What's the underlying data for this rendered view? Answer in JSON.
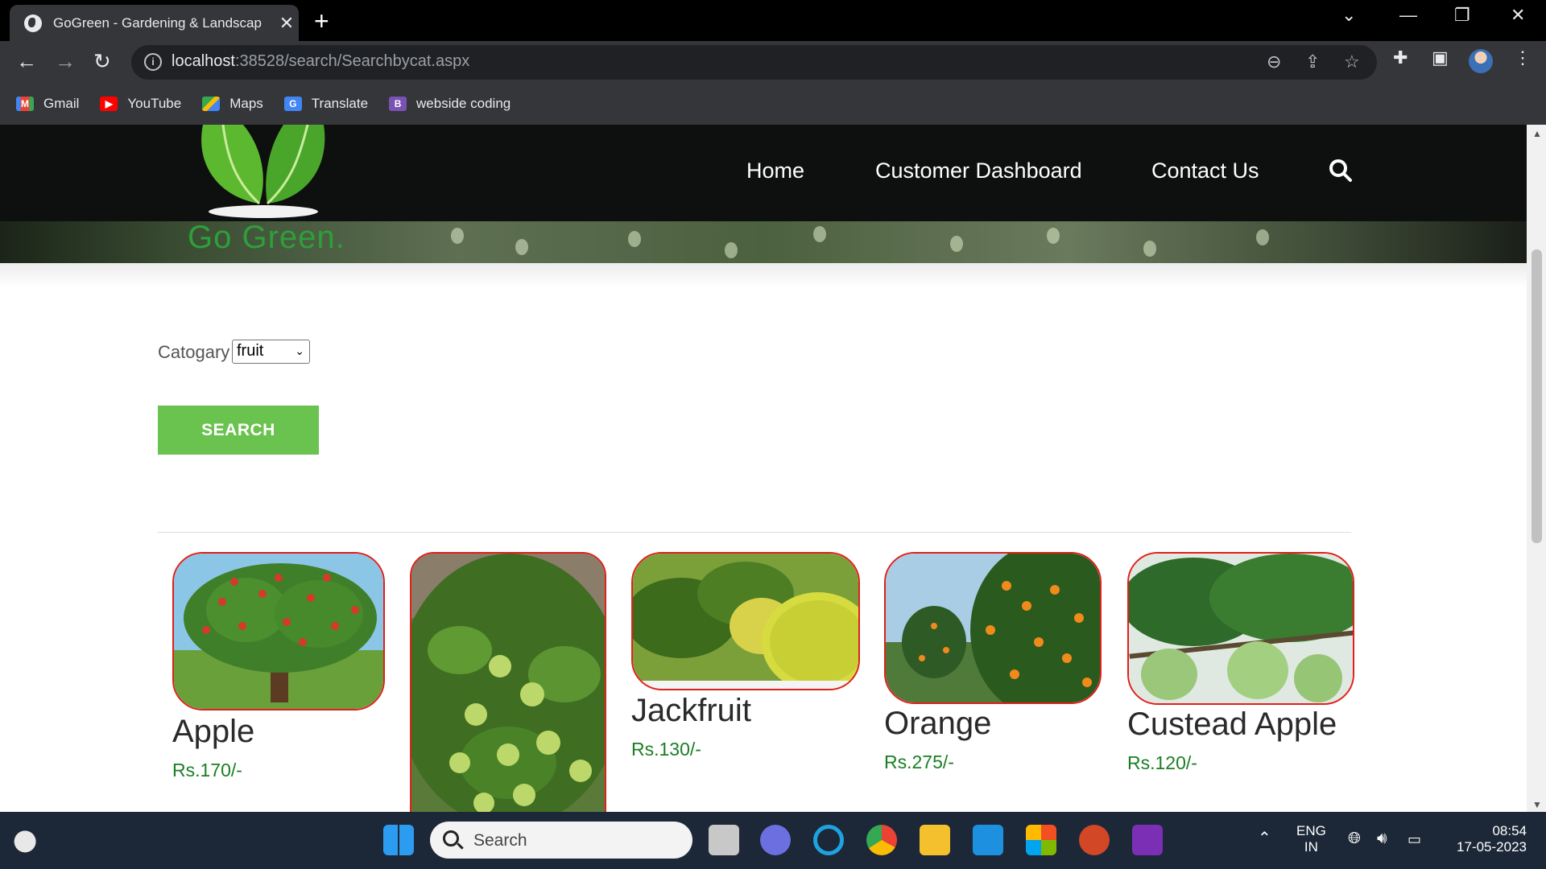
{
  "browser": {
    "tab_title": "GoGreen - Gardening & Landscap",
    "url_host": "localhost",
    "url_path": ":38528/search/Searchbycat.aspx",
    "bookmarks": [
      {
        "label": "Gmail",
        "icon": "gmail-icon"
      },
      {
        "label": "YouTube",
        "icon": "youtube-icon"
      },
      {
        "label": "Maps",
        "icon": "maps-icon"
      },
      {
        "label": "Translate",
        "icon": "translate-icon"
      },
      {
        "label": "webside coding",
        "icon": "bootstrap-icon"
      }
    ]
  },
  "site": {
    "logo_text": "Go Green.",
    "nav": [
      "Home",
      "Customer Dashboard",
      "Contact Us"
    ]
  },
  "search_form": {
    "category_label": "Catogary",
    "category_value": "fruit",
    "search_button": "SEARCH"
  },
  "products": [
    {
      "name": "Apple",
      "price": "Rs.170/-"
    },
    {
      "name": "",
      "price": ""
    },
    {
      "name": "Jackfruit",
      "price": "Rs.130/-"
    },
    {
      "name": "Orange",
      "price": "Rs.275/-"
    },
    {
      "name": "Custead Apple",
      "price": "Rs.120/-"
    }
  ],
  "taskbar": {
    "search_placeholder": "Search",
    "lang_line1": "ENG",
    "lang_line2": "IN",
    "time": "08:54",
    "date": "17-05-2023"
  },
  "colors": {
    "accent_green": "#6ac24f",
    "price_green": "#1a7f23",
    "image_border": "#e0201a"
  }
}
